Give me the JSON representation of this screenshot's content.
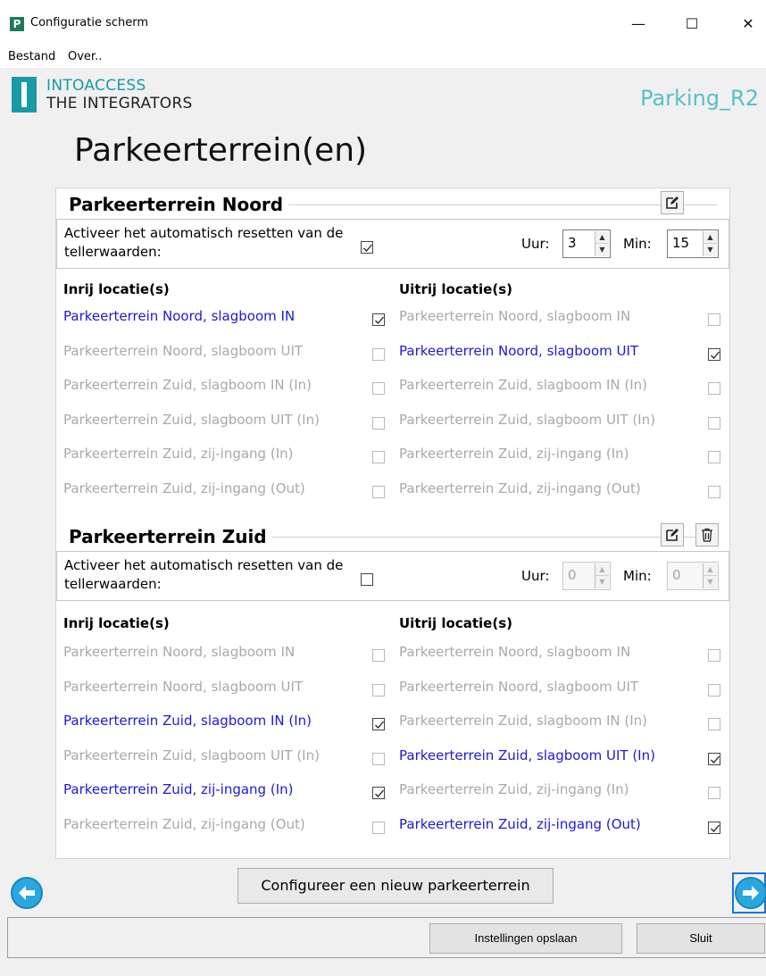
{
  "window": {
    "title": "Configuratie scherm",
    "minimize": "—",
    "maximize": "☐",
    "close": "✕",
    "app_icon": "P"
  },
  "menu": [
    "Bestand",
    "Over.."
  ],
  "brand": {
    "line1": "INTOACCESS",
    "line2": "THE INTEGRATORS",
    "app_name": "Parking_R2"
  },
  "page_title": "Parkeerterrein(en)",
  "groups": [
    {
      "title": "Parkeerterrein Noord",
      "reset_label": "Activeer het automatisch resetten van de tellerwaarden:",
      "reset_checked": true,
      "uur_label": "Uur:",
      "uur_value": "3",
      "min_label": "Min:",
      "min_value": "15",
      "spin_enabled": true,
      "in_header": "Inrij locatie(s)",
      "out_header": "Uitrij locatie(s)",
      "in_locations": [
        {
          "label": "Parkeerterrein Noord, slagboom IN",
          "checked": true
        },
        {
          "label": "Parkeerterrein Noord, slagboom UIT",
          "checked": false
        },
        {
          "label": "Parkeerterrein Zuid, slagboom IN (In)",
          "checked": false
        },
        {
          "label": "Parkeerterrein Zuid, slagboom UIT (In)",
          "checked": false
        },
        {
          "label": "Parkeerterrein Zuid, zij-ingang (In)",
          "checked": false
        },
        {
          "label": "Parkeerterrein Zuid, zij-ingang (Out)",
          "checked": false
        }
      ],
      "out_locations": [
        {
          "label": "Parkeerterrein Noord, slagboom IN",
          "checked": false
        },
        {
          "label": "Parkeerterrein Noord, slagboom UIT",
          "checked": true
        },
        {
          "label": "Parkeerterrein Zuid, slagboom IN (In)",
          "checked": false
        },
        {
          "label": "Parkeerterrein Zuid, slagboom UIT (In)",
          "checked": false
        },
        {
          "label": "Parkeerterrein Zuid, zij-ingang (In)",
          "checked": false
        },
        {
          "label": "Parkeerterrein Zuid, zij-ingang (Out)",
          "checked": false
        }
      ],
      "icons": [
        "edit-icon"
      ]
    },
    {
      "title": "Parkeerterrein Zuid",
      "reset_label": "Activeer het automatisch resetten van de tellerwaarden:",
      "reset_checked": false,
      "uur_label": "Uur:",
      "uur_value": "0",
      "min_label": "Min:",
      "min_value": "0",
      "spin_enabled": false,
      "in_header": "Inrij locatie(s)",
      "out_header": "Uitrij locatie(s)",
      "in_locations": [
        {
          "label": "Parkeerterrein Noord, slagboom IN",
          "checked": false
        },
        {
          "label": "Parkeerterrein Noord, slagboom UIT",
          "checked": false
        },
        {
          "label": "Parkeerterrein Zuid, slagboom IN (In)",
          "checked": true
        },
        {
          "label": "Parkeerterrein Zuid, slagboom UIT (In)",
          "checked": false
        },
        {
          "label": "Parkeerterrein Zuid, zij-ingang (In)",
          "checked": true
        },
        {
          "label": "Parkeerterrein Zuid, zij-ingang (Out)",
          "checked": false
        }
      ],
      "out_locations": [
        {
          "label": "Parkeerterrein Noord, slagboom IN",
          "checked": false
        },
        {
          "label": "Parkeerterrein Noord, slagboom UIT",
          "checked": false
        },
        {
          "label": "Parkeerterrein Zuid, slagboom IN (In)",
          "checked": false
        },
        {
          "label": "Parkeerterrein Zuid, slagboom UIT (In)",
          "checked": true
        },
        {
          "label": "Parkeerterrein Zuid, zij-ingang (In)",
          "checked": false
        },
        {
          "label": "Parkeerterrein Zuid, zij-ingang (Out)",
          "checked": true
        }
      ],
      "icons": [
        "edit-icon",
        "trash-icon"
      ]
    }
  ],
  "buttons": {
    "configure_new": "Configureer een nieuw parkeerterrein",
    "save": "Instellingen opslaan",
    "close": "Sluit"
  },
  "nav": {
    "prev_icon": "arrow-left-icon",
    "next_icon": "arrow-right-icon"
  },
  "colors": {
    "brand": "#1a9aa6",
    "active_location": "#1a1adb",
    "inactive_location": "#a9a9a9",
    "nav_button": "#29a8e0"
  }
}
